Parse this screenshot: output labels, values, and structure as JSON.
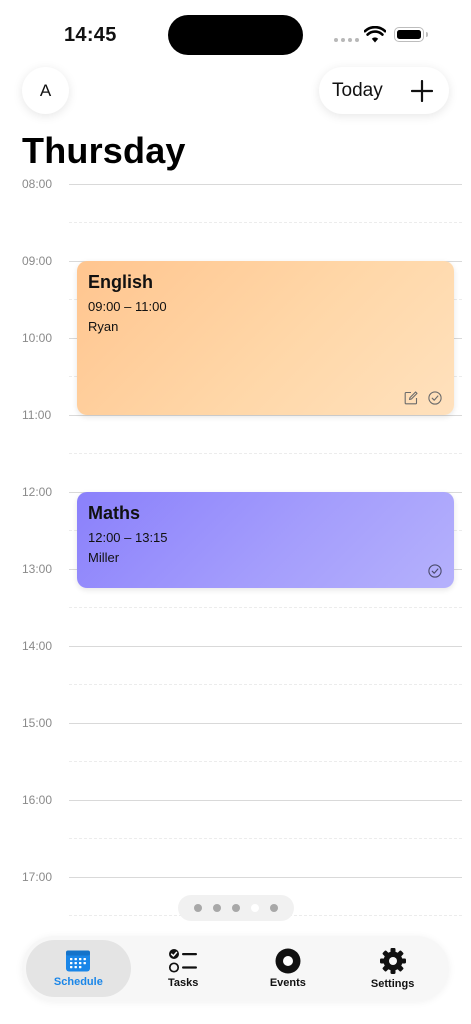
{
  "status_bar": {
    "time": "14:45",
    "icons": [
      "signal-dots-icon",
      "wifi-icon",
      "battery-icon"
    ]
  },
  "header": {
    "avatar_initial": "A",
    "today_label": "Today",
    "add_icon": "plus-icon"
  },
  "day": {
    "title": "Thursday"
  },
  "timeline": {
    "hours": [
      "08:00",
      "09:00",
      "10:00",
      "11:00",
      "12:00",
      "13:00",
      "14:00",
      "15:00",
      "16:00",
      "17:00"
    ]
  },
  "events": [
    {
      "title": "English",
      "time": "09:00 – 11:00",
      "person": "Ryan",
      "color": "#ffc58f",
      "icons": [
        "edit-note-icon",
        "check-circle-icon"
      ]
    },
    {
      "title": "Maths",
      "time": "12:00 – 13:15",
      "person": "Miller",
      "color": "#8a80fb",
      "icons": [
        "check-circle-icon"
      ]
    }
  ],
  "pager": {
    "count": 5,
    "active_index": 3
  },
  "tab_bar": {
    "accent": "#1a86e8",
    "tabs": [
      {
        "label": "Schedule",
        "icon": "calendar-icon",
        "active": true
      },
      {
        "label": "Tasks",
        "icon": "checklist-icon",
        "active": false
      },
      {
        "label": "Events",
        "icon": "record-circle-icon",
        "active": false
      },
      {
        "label": "Settings",
        "icon": "gear-icon",
        "active": false
      }
    ]
  }
}
